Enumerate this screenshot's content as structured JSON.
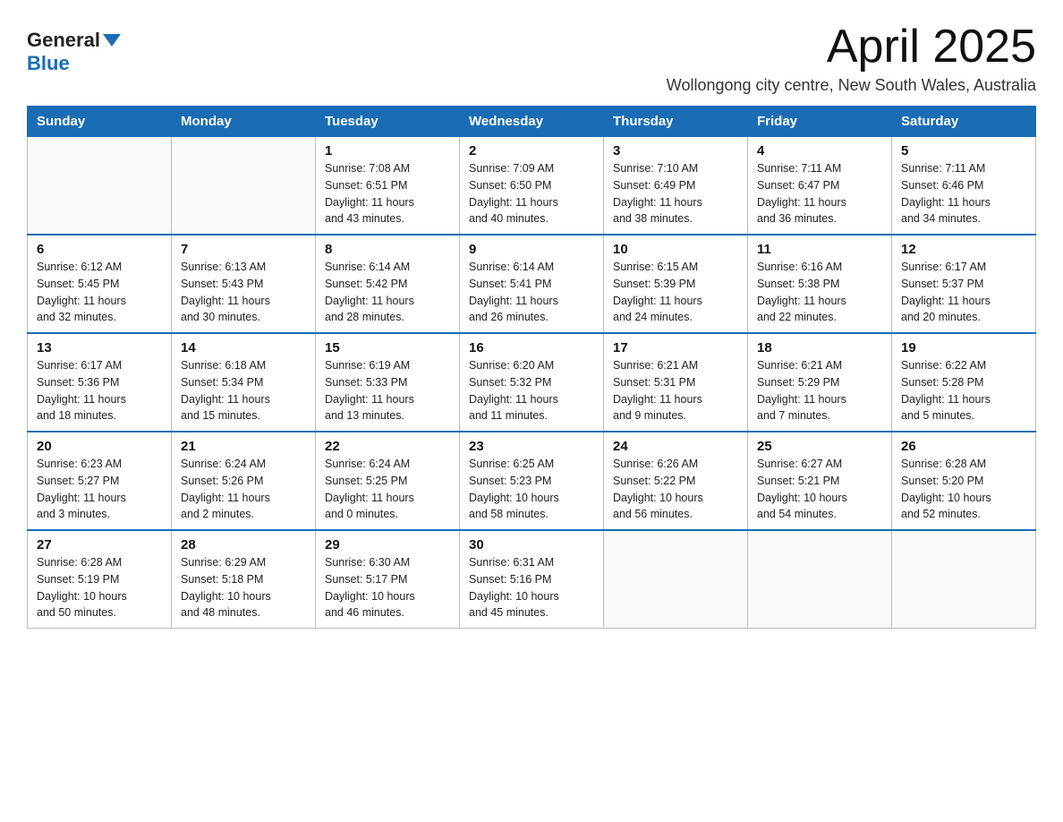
{
  "header": {
    "logo_general": "General",
    "logo_blue": "Blue",
    "month_title": "April 2025",
    "location": "Wollongong city centre, New South Wales, Australia"
  },
  "days_of_week": [
    "Sunday",
    "Monday",
    "Tuesday",
    "Wednesday",
    "Thursday",
    "Friday",
    "Saturday"
  ],
  "weeks": [
    [
      {
        "num": "",
        "info": ""
      },
      {
        "num": "",
        "info": ""
      },
      {
        "num": "1",
        "info": "Sunrise: 7:08 AM\nSunset: 6:51 PM\nDaylight: 11 hours\nand 43 minutes."
      },
      {
        "num": "2",
        "info": "Sunrise: 7:09 AM\nSunset: 6:50 PM\nDaylight: 11 hours\nand 40 minutes."
      },
      {
        "num": "3",
        "info": "Sunrise: 7:10 AM\nSunset: 6:49 PM\nDaylight: 11 hours\nand 38 minutes."
      },
      {
        "num": "4",
        "info": "Sunrise: 7:11 AM\nSunset: 6:47 PM\nDaylight: 11 hours\nand 36 minutes."
      },
      {
        "num": "5",
        "info": "Sunrise: 7:11 AM\nSunset: 6:46 PM\nDaylight: 11 hours\nand 34 minutes."
      }
    ],
    [
      {
        "num": "6",
        "info": "Sunrise: 6:12 AM\nSunset: 5:45 PM\nDaylight: 11 hours\nand 32 minutes."
      },
      {
        "num": "7",
        "info": "Sunrise: 6:13 AM\nSunset: 5:43 PM\nDaylight: 11 hours\nand 30 minutes."
      },
      {
        "num": "8",
        "info": "Sunrise: 6:14 AM\nSunset: 5:42 PM\nDaylight: 11 hours\nand 28 minutes."
      },
      {
        "num": "9",
        "info": "Sunrise: 6:14 AM\nSunset: 5:41 PM\nDaylight: 11 hours\nand 26 minutes."
      },
      {
        "num": "10",
        "info": "Sunrise: 6:15 AM\nSunset: 5:39 PM\nDaylight: 11 hours\nand 24 minutes."
      },
      {
        "num": "11",
        "info": "Sunrise: 6:16 AM\nSunset: 5:38 PM\nDaylight: 11 hours\nand 22 minutes."
      },
      {
        "num": "12",
        "info": "Sunrise: 6:17 AM\nSunset: 5:37 PM\nDaylight: 11 hours\nand 20 minutes."
      }
    ],
    [
      {
        "num": "13",
        "info": "Sunrise: 6:17 AM\nSunset: 5:36 PM\nDaylight: 11 hours\nand 18 minutes."
      },
      {
        "num": "14",
        "info": "Sunrise: 6:18 AM\nSunset: 5:34 PM\nDaylight: 11 hours\nand 15 minutes."
      },
      {
        "num": "15",
        "info": "Sunrise: 6:19 AM\nSunset: 5:33 PM\nDaylight: 11 hours\nand 13 minutes."
      },
      {
        "num": "16",
        "info": "Sunrise: 6:20 AM\nSunset: 5:32 PM\nDaylight: 11 hours\nand 11 minutes."
      },
      {
        "num": "17",
        "info": "Sunrise: 6:21 AM\nSunset: 5:31 PM\nDaylight: 11 hours\nand 9 minutes."
      },
      {
        "num": "18",
        "info": "Sunrise: 6:21 AM\nSunset: 5:29 PM\nDaylight: 11 hours\nand 7 minutes."
      },
      {
        "num": "19",
        "info": "Sunrise: 6:22 AM\nSunset: 5:28 PM\nDaylight: 11 hours\nand 5 minutes."
      }
    ],
    [
      {
        "num": "20",
        "info": "Sunrise: 6:23 AM\nSunset: 5:27 PM\nDaylight: 11 hours\nand 3 minutes."
      },
      {
        "num": "21",
        "info": "Sunrise: 6:24 AM\nSunset: 5:26 PM\nDaylight: 11 hours\nand 2 minutes."
      },
      {
        "num": "22",
        "info": "Sunrise: 6:24 AM\nSunset: 5:25 PM\nDaylight: 11 hours\nand 0 minutes."
      },
      {
        "num": "23",
        "info": "Sunrise: 6:25 AM\nSunset: 5:23 PM\nDaylight: 10 hours\nand 58 minutes."
      },
      {
        "num": "24",
        "info": "Sunrise: 6:26 AM\nSunset: 5:22 PM\nDaylight: 10 hours\nand 56 minutes."
      },
      {
        "num": "25",
        "info": "Sunrise: 6:27 AM\nSunset: 5:21 PM\nDaylight: 10 hours\nand 54 minutes."
      },
      {
        "num": "26",
        "info": "Sunrise: 6:28 AM\nSunset: 5:20 PM\nDaylight: 10 hours\nand 52 minutes."
      }
    ],
    [
      {
        "num": "27",
        "info": "Sunrise: 6:28 AM\nSunset: 5:19 PM\nDaylight: 10 hours\nand 50 minutes."
      },
      {
        "num": "28",
        "info": "Sunrise: 6:29 AM\nSunset: 5:18 PM\nDaylight: 10 hours\nand 48 minutes."
      },
      {
        "num": "29",
        "info": "Sunrise: 6:30 AM\nSunset: 5:17 PM\nDaylight: 10 hours\nand 46 minutes."
      },
      {
        "num": "30",
        "info": "Sunrise: 6:31 AM\nSunset: 5:16 PM\nDaylight: 10 hours\nand 45 minutes."
      },
      {
        "num": "",
        "info": ""
      },
      {
        "num": "",
        "info": ""
      },
      {
        "num": "",
        "info": ""
      }
    ]
  ]
}
